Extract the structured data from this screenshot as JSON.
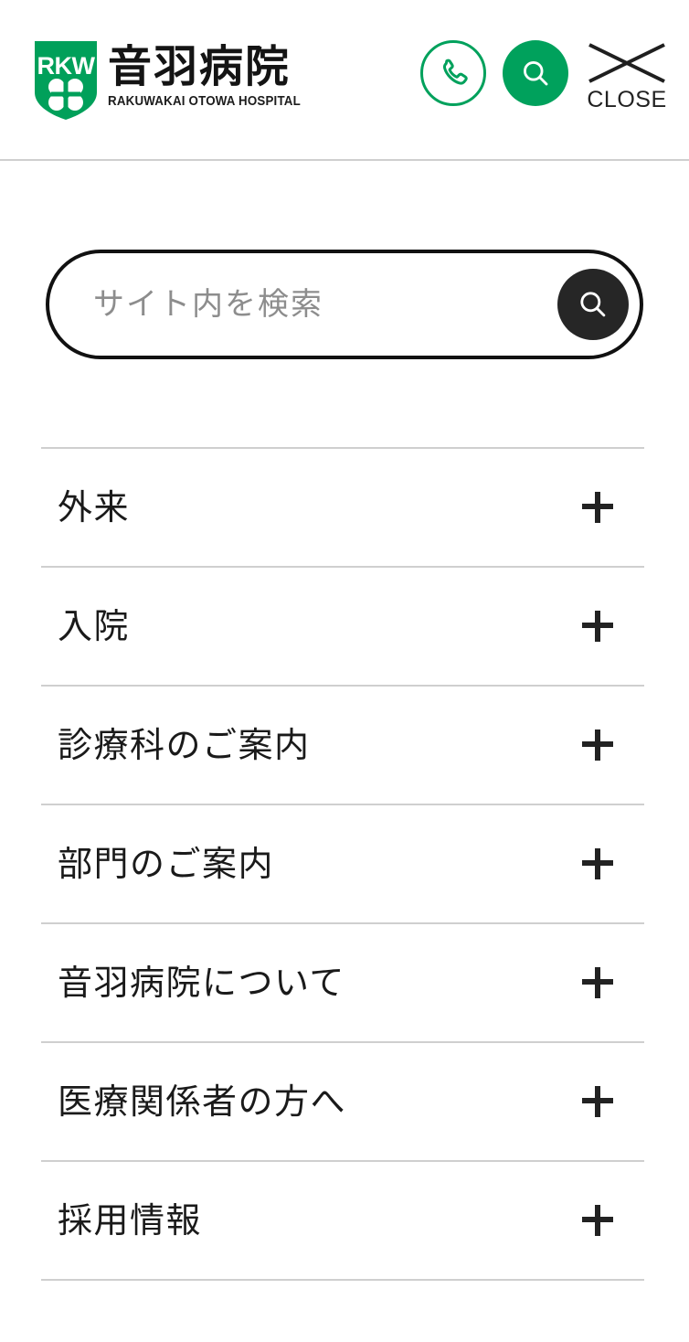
{
  "header": {
    "logo": {
      "badge_text": "RKW",
      "badge_icon": "clover-emblem-icon",
      "hospital_name_jp": "音羽病院",
      "hospital_name_en": "RAKUWAKAI OTOWA HOSPITAL"
    },
    "actions": {
      "phone": {
        "icon": "phone-icon",
        "label": ""
      },
      "search": {
        "icon": "search-icon",
        "label": ""
      },
      "close": {
        "icon": "close-x-icon",
        "label": "CLOSE"
      }
    }
  },
  "search": {
    "placeholder": "サイト内を検索",
    "value": "",
    "submit_icon": "search-icon"
  },
  "nav": {
    "expand_icon": "plus-icon",
    "items": [
      {
        "label": "外来"
      },
      {
        "label": "入院"
      },
      {
        "label": "診療科のご案内"
      },
      {
        "label": "部門のご案内"
      },
      {
        "label": "音羽病院について"
      },
      {
        "label": "医療関係者の方へ"
      },
      {
        "label": "採用情報"
      }
    ]
  },
  "colors": {
    "brand_green": "#00a15c",
    "text_dark": "#1a1a1a",
    "divider": "#cfcfcf",
    "submit_dark": "#262626",
    "placeholder_gray": "#8d8d8d"
  }
}
